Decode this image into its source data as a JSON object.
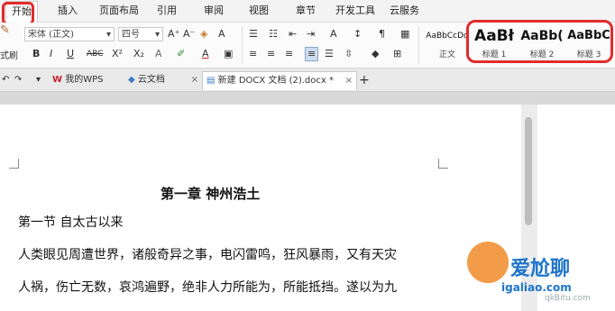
{
  "menu": {
    "tabs": [
      "开始",
      "插入",
      "页面布局",
      "引用",
      "审阅",
      "视图",
      "章节",
      "开发工具",
      "云服务"
    ]
  },
  "ribbon": {
    "format_label": "式刷",
    "font_name": "宋体 (正文)",
    "font_size": "四号",
    "grow_font": "A⁺",
    "shrink_font": "A⁻",
    "bold": "B",
    "italic": "I",
    "underline": "U",
    "strike": "ABC",
    "superscript": "X²",
    "subscript": "X₂",
    "font_color": "A",
    "styles": [
      {
        "sample": "AaBbCcDd",
        "label": "正文"
      },
      {
        "sample": "AaBł",
        "label": "标题 1"
      },
      {
        "sample": "AaBb(",
        "label": "标题 2"
      },
      {
        "sample": "AaBbC",
        "label": "标题 3"
      }
    ]
  },
  "tabs": {
    "items": [
      "我的WPS",
      "云文档",
      "新建 DOCX 文档 (2).docx *"
    ],
    "add": "+"
  },
  "document": {
    "chapter_title": "第一章    神州浩土",
    "section_title": "第一节  自太古以来",
    "para1": "人类眼见周遭世界，诸般奇异之事，电闪雷鸣，狂风暴雨，又有天灾",
    "para2": "人祸，伤亡无数，哀鸿遍野，绝非人力所能为，所能抵挡。遂以为九"
  },
  "watermark": {
    "text_cn": "爱尬聊",
    "text_url": "igaliao.com",
    "text_small": "qkBitu.com"
  },
  "colors": {
    "highlight": "#e12b2b",
    "wps_red": "#c8202e"
  }
}
